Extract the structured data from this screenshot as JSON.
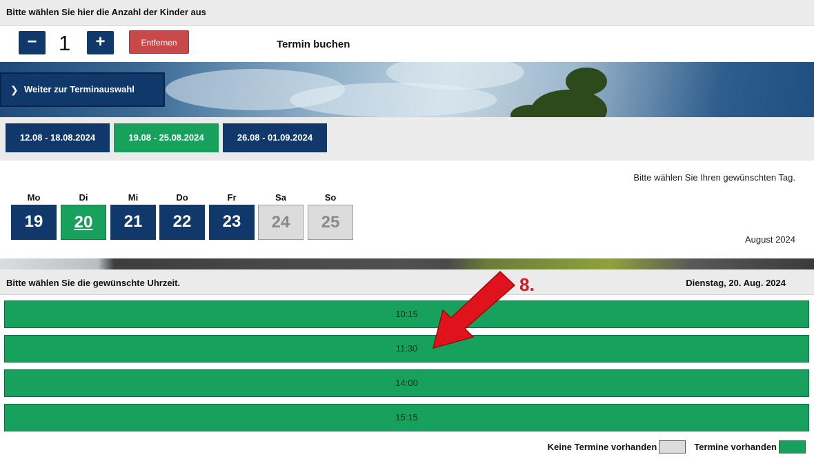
{
  "header": {
    "title": "Bitte wählen Sie hier die Anzahl der Kinder aus"
  },
  "counter": {
    "minus": "−",
    "value": "1",
    "plus": "+",
    "remove_label": "Entfernen"
  },
  "booking": {
    "title": "Termin buchen"
  },
  "weiter": {
    "label": "Weiter zur Terminauswahl"
  },
  "weeks": [
    {
      "label": "12.08 - 18.08.2024",
      "selected": false
    },
    {
      "label": "19.08 - 25.08.2024",
      "selected": true
    },
    {
      "label": "26.08 - 01.09.2024",
      "selected": false
    }
  ],
  "days_panel": {
    "instruction": "Bitte wählen Sie Ihren gewünschten Tag.",
    "month": "August 2024",
    "days": [
      {
        "name": "Mo",
        "num": "19",
        "state": "available"
      },
      {
        "name": "Di",
        "num": "20",
        "state": "selected"
      },
      {
        "name": "Mi",
        "num": "21",
        "state": "available"
      },
      {
        "name": "Do",
        "num": "22",
        "state": "available"
      },
      {
        "name": "Fr",
        "num": "23",
        "state": "available"
      },
      {
        "name": "Sa",
        "num": "24",
        "state": "none"
      },
      {
        "name": "So",
        "num": "25",
        "state": "none"
      }
    ]
  },
  "times": {
    "instruction": "Bitte wählen Sie die gewünschte Uhrzeit.",
    "date": "Dienstag, 20. Aug. 2024",
    "slots": [
      "10:15",
      "11:30",
      "14:00",
      "15:15"
    ]
  },
  "legend": {
    "none": "Keine Termine vorhanden",
    "available": "Termine vorhanden"
  },
  "annotation": {
    "step": "8."
  },
  "colors": {
    "navy": "#10386b",
    "green": "#18a15c",
    "red": "#c9494a",
    "arrow": "#e0121b"
  }
}
